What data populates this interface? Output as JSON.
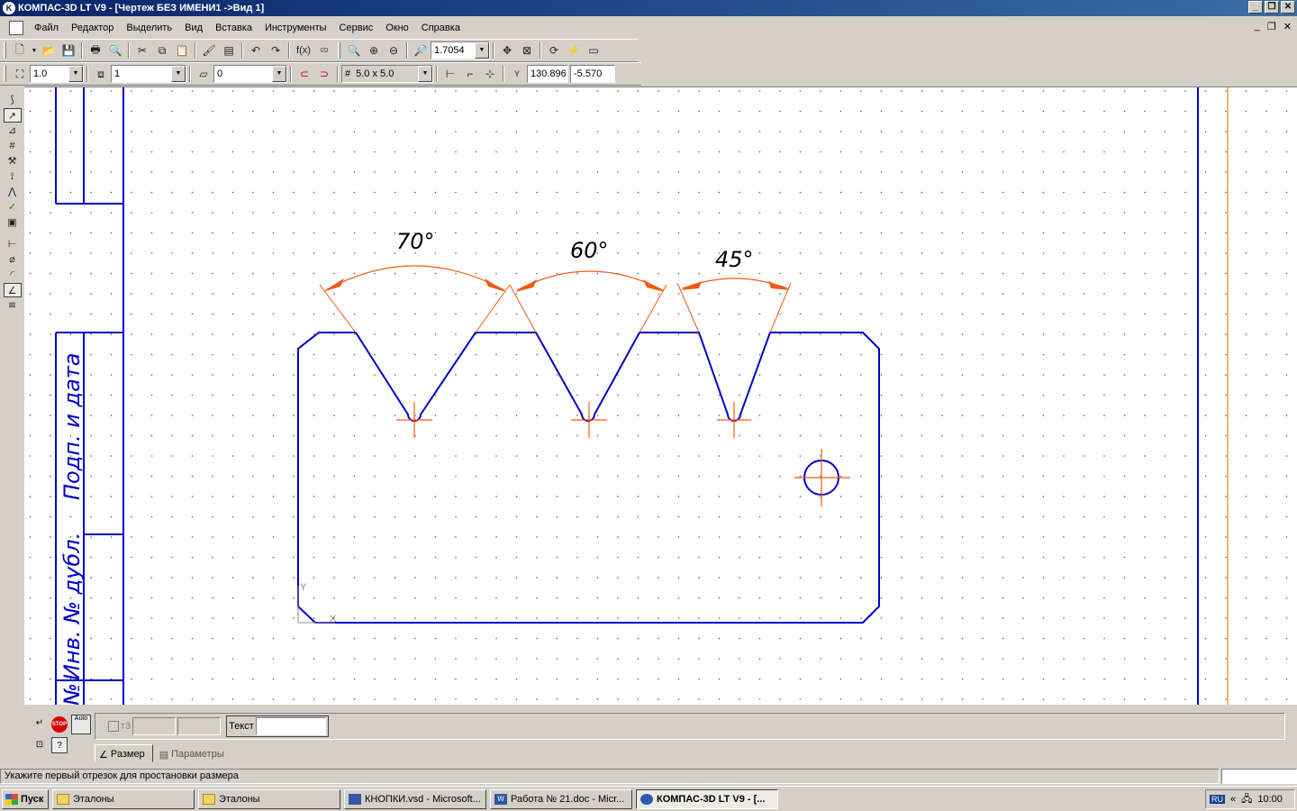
{
  "window": {
    "title": "КОМПАС-3D LT V9 - [Чертеж БЕЗ ИМЕНИ1 ->Вид 1]"
  },
  "menu": [
    "Файл",
    "Редактор",
    "Выделить",
    "Вид",
    "Вставка",
    "Инструменты",
    "Сервис",
    "Окно",
    "Справка"
  ],
  "toolbar1": {
    "zoom": "1.7054",
    "fx_label": "f(x)"
  },
  "toolbar2": {
    "line_style": "1.0",
    "layer": "1",
    "layer2": "0",
    "grid": "5.0 x 5.0",
    "coord_x": "130.896",
    "coord_y": "-5.570"
  },
  "drawing": {
    "angle_labels": [
      "70°",
      "60°",
      "45°"
    ],
    "stamp_labels": [
      "Подп. и дата",
      "Инв. № дубл.",
      "№"
    ],
    "axis_labels": {
      "x": "X",
      "y": "Y"
    }
  },
  "prop_panel": {
    "field_t3": "т3",
    "text_label": "Текст",
    "text_value": "",
    "stop_label": "STOP",
    "auto_label": "Auto",
    "help_label": "?",
    "tabs": [
      "Размер",
      "Параметры"
    ]
  },
  "status": {
    "message": "Укажите первый отрезок для простановки размера"
  },
  "taskbar": {
    "start": "Пуск",
    "tasks": [
      "Эталоны",
      "Эталоны",
      "КНОПКИ.vsd - Microsoft...",
      "Работа № 21.doc - Micr...",
      "КОМПАС-3D LT V9 - [..."
    ],
    "lang": "RU",
    "clock": "10:00",
    "chevron": "«"
  },
  "colors": {
    "geometry": "#0000c8",
    "construction": "#f05a14",
    "frame": "#0000c8"
  }
}
